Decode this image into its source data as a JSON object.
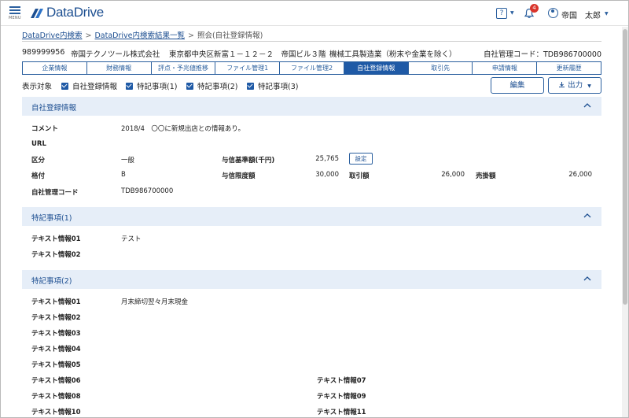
{
  "header": {
    "menu_label": "MENU",
    "logo_text": "DataDrive",
    "notification_count": "4",
    "user_name": "帝国　太郎"
  },
  "breadcrumb": {
    "item1": "DataDrive内検索",
    "item2": "DataDrive内検索結果一覧",
    "current": "照会(自社登録情報)",
    "separator": ">"
  },
  "company": {
    "code": "989999956",
    "name": "帝国テクノツール株式会社",
    "address": "東京都中央区新富１－１２－２　帝国ビル３階",
    "industry": "機械工具製造業（粉末や金業を除く）",
    "internal_code_label": "自社管理コード：TDB986700000"
  },
  "tabs": [
    "企業情報",
    "財務情報",
    "評点・予兆値推移",
    "ファイル管理1",
    "ファイル管理2",
    "自社登録情報",
    "取引先",
    "申請情報",
    "更新履歴"
  ],
  "filters": {
    "label": "表示対象",
    "options": [
      "自社登録情報",
      "特記事項(1)",
      "特記事項(2)",
      "特記事項(3)"
    ]
  },
  "actions": {
    "edit": "編集",
    "output": "出力"
  },
  "section_own": {
    "title": "自社登録情報",
    "comment_label": "コメント",
    "comment_value": "2018/4　〇〇に新規出店との情報あり。",
    "url_label": "URL",
    "category_label": "区分",
    "category_value": "一般",
    "credit_base_label": "与信基準額(千円)",
    "credit_base_value": "25,765",
    "setting_button": "設定",
    "rating_label": "格付",
    "rating_value": "B",
    "credit_limit_label": "与信限度額",
    "credit_limit_value": "30,000",
    "trade_label": "取引額",
    "trade_value": "26,000",
    "receivable_label": "売掛額",
    "receivable_value": "26,000",
    "mgmt_code_label": "自社管理コード",
    "mgmt_code_value": "TDB986700000"
  },
  "section_note1": {
    "title": "特記事項(1)",
    "t01_label": "テキスト情報01",
    "t01_value": "テスト",
    "t02_label": "テキスト情報02"
  },
  "section_note2": {
    "title": "特記事項(2)",
    "t01_label": "テキスト情報01",
    "t01_value": "月末締切翌々月末現金",
    "t02_label": "テキスト情報02",
    "t03_label": "テキスト情報03",
    "t04_label": "テキスト情報04",
    "t05_label": "テキスト情報05",
    "t06_label": "テキスト情報06",
    "t07_label": "テキスト情報07",
    "t08_label": "テキスト情報08",
    "t09_label": "テキスト情報09",
    "t10_label": "テキスト情報10",
    "t11_label": "テキスト情報11"
  }
}
